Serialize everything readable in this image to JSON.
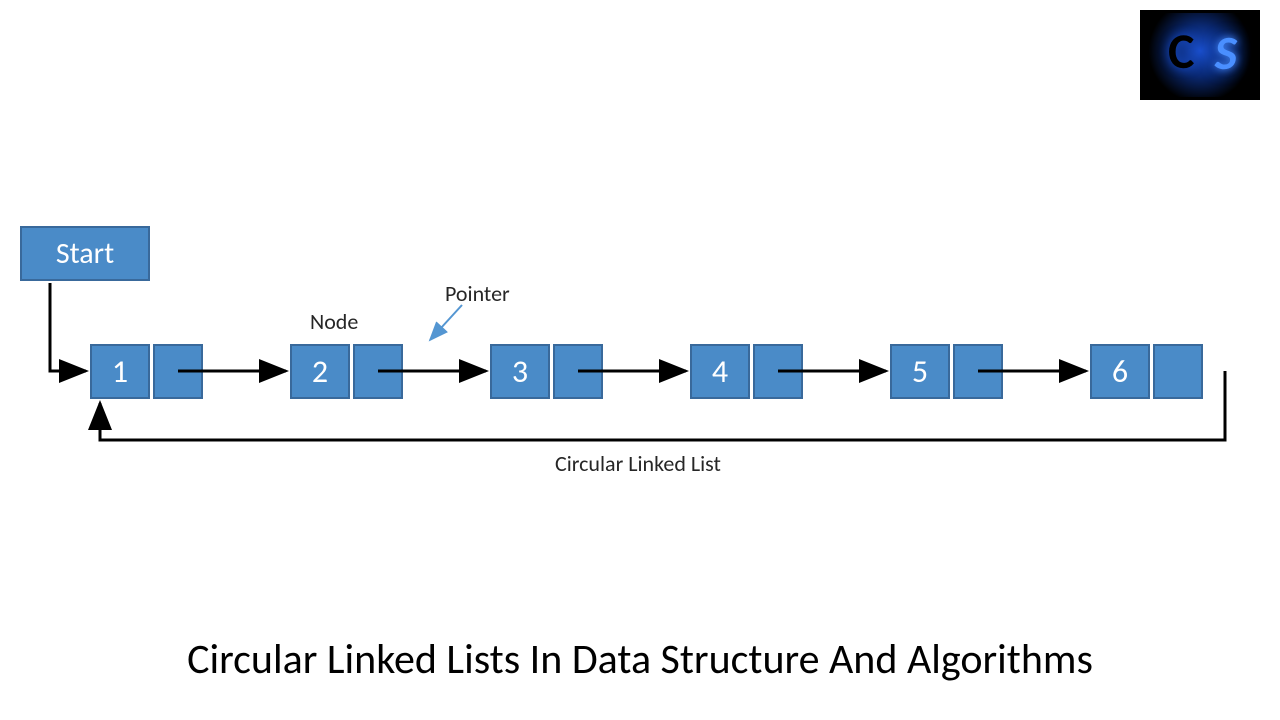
{
  "diagram": {
    "start_label": "Start",
    "nodes": [
      "1",
      "2",
      "3",
      "4",
      "5",
      "6"
    ],
    "annotations": {
      "node_label": "Node",
      "pointer_label": "Pointer",
      "loop_label": "Circular Linked List"
    },
    "caption": "Circular Linked Lists In Data Structure And Algorithms",
    "logo": {
      "char1": "C",
      "char2": "S"
    },
    "colors": {
      "node_fill": "#4a8bc8",
      "node_border": "#39699b",
      "text": "#262626",
      "pointer_accent": "#5496d2"
    }
  }
}
